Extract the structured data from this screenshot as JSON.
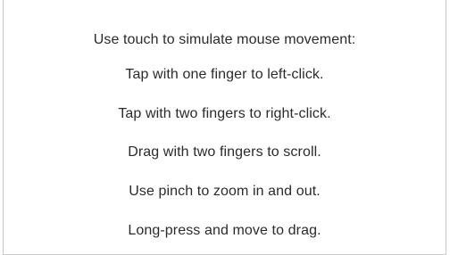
{
  "dialog": {
    "intro": "Use touch to simulate mouse movement:",
    "instructions": [
      "Tap with one finger to left-click.",
      "Tap with two fingers to right-click.",
      "Drag with two fingers to scroll.",
      "Use pinch to zoom in and out.",
      "Long-press and move to drag."
    ]
  }
}
